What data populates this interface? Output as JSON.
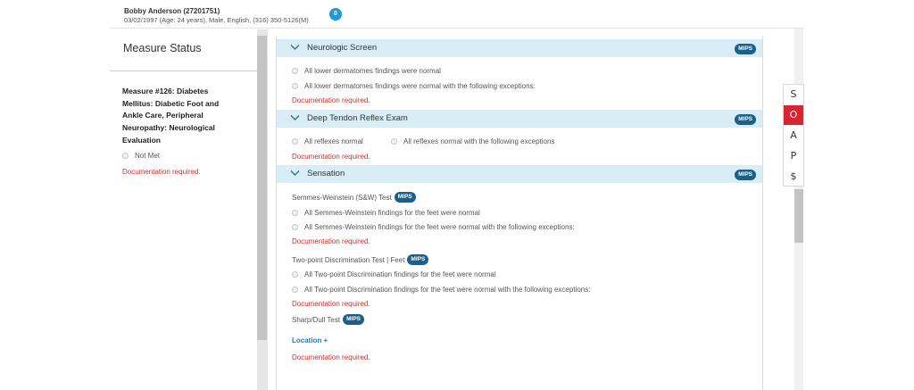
{
  "patient": {
    "name": "Bobby Anderson (27201751)",
    "info": "03/02/1997 (Age: 24 years), Male, English, (316) 350-5126(M)",
    "badge": "0"
  },
  "left_panel": {
    "title": "Measure Status",
    "measure": "Measure #126: Diabetes Mellitus: Diabetic Foot and Ankle Care, Peripheral Neuropathy: Neurological Evaluation",
    "not_met_label": "Not Met",
    "doc_required": "Documentation required."
  },
  "sections": {
    "neuro": {
      "title": "Neurologic Screen",
      "badge": "MIPS",
      "opt1": "All lower dermatomes findings were normal",
      "opt2": "All lower dermatomes findings were normal with the following exceptions:",
      "doc_required": "Documentation required."
    },
    "dtr": {
      "title": "Deep Tendon Reflex Exam",
      "badge": "MIPS",
      "opt1": "All reflexes normal",
      "opt2": "All reflexes normal with the following exceptions",
      "doc_required": "Documentation required."
    },
    "sensation": {
      "title": "Sensation",
      "badge": "MIPS",
      "sw_label": "Semmes-Weinstein (S&W) Test",
      "sw_badge": "MIPS",
      "sw_opt1": "All Semmes-Weinstein findings for the feet were normal",
      "sw_opt2": "All Semmes-Weinstein findings for the feet were normal with the following exceptions:",
      "sw_doc_required": "Documentation required.",
      "tp_label": "Two-point Discrimination Test | Feet",
      "tp_badge": "MIPS",
      "tp_opt1": "All Two-point Discrimination findings for the feet were normal",
      "tp_opt2": "All Two-point Discrimination findings for the feet were normal with the following exceptions:",
      "tp_doc_required": "Documentation required.",
      "sd_label": "Sharp/Dull Test",
      "sd_badge": "MIPS",
      "location_link": "Location +",
      "sd_doc_required": "Documentation required."
    }
  },
  "soap": [
    "S",
    "O",
    "A",
    "P",
    "$"
  ],
  "colors": {
    "section_header": "#d9edf7",
    "mips_badge": "#1b5f8a",
    "doc_required": "#c9302c",
    "soap_active": "#d9262e",
    "link": "#1b7fbf"
  }
}
